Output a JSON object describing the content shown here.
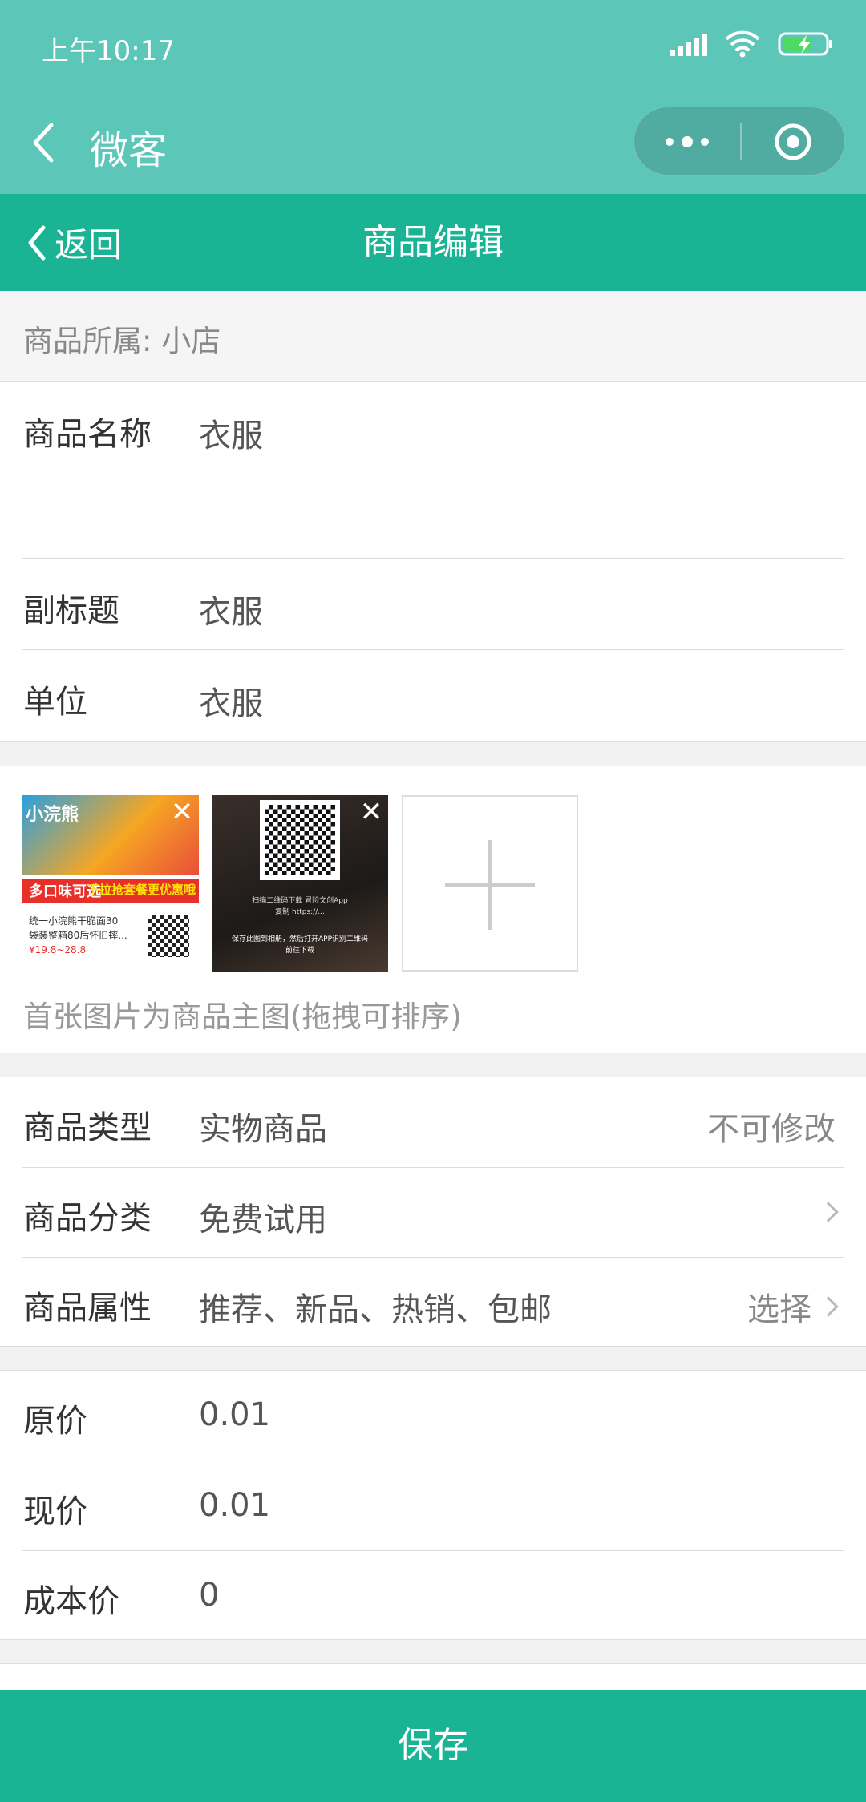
{
  "status": {
    "time": "上午10:17"
  },
  "titlebar": {
    "title": "微客"
  },
  "nav": {
    "back_label": "返回",
    "title": "商品编辑"
  },
  "owner": {
    "text": "商品所属: 小店"
  },
  "basic": [
    {
      "label": "商品名称",
      "value": "衣服"
    },
    {
      "label": "副标题",
      "value": "衣服"
    },
    {
      "label": "单位",
      "value": "衣服"
    }
  ],
  "images": {
    "thumb1": {
      "brand": "小浣熊",
      "banner_left": "多口味可选",
      "banner_right": "下拉抢套餐更优惠哦",
      "desc_line1": "统一小浣熊干脆面30",
      "desc_line2": "袋装整箱80后怀旧摔...",
      "price": "¥19.8~28.8"
    },
    "thumb2": {
      "line1": "扫描二维码下载 冒险文创App",
      "line2": "复制 https://...",
      "line3": "保存此图到相册，然后打开APP识别二维码",
      "line4": "前往下载"
    },
    "hint": "首张图片为商品主图(拖拽可排序)"
  },
  "type_section": [
    {
      "label": "商品类型",
      "value": "实物商品",
      "right": "不可修改"
    },
    {
      "label": "商品分类",
      "value": "免费试用",
      "right": ""
    },
    {
      "label": "商品属性",
      "value": "推荐、新品、热销、包邮",
      "right": "选择"
    }
  ],
  "price_section": [
    {
      "label": "原价",
      "value": "0.01"
    },
    {
      "label": "现价",
      "value": "0.01"
    },
    {
      "label": "成本价",
      "value": "0"
    }
  ],
  "save_label": "保存",
  "colors": {
    "primary": "#1ab394",
    "titlebar": "#5cc6b9"
  }
}
